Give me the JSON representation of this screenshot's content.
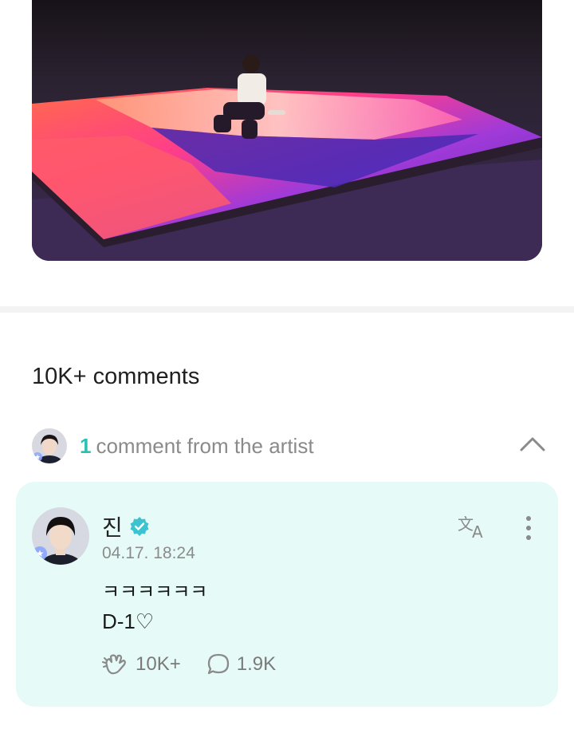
{
  "post": {
    "photo_alt": "artist photo"
  },
  "comments_section": {
    "count_label": "10K+ comments"
  },
  "artist_comments": {
    "count": "1",
    "label": "comment from the artist"
  },
  "comment": {
    "author": "진",
    "timestamp": "04.17. 18:24",
    "line1": "ㅋㅋㅋㅋㅋㅋ",
    "line2": "D-1♡",
    "likes": "10K+",
    "replies": "1.9K"
  },
  "icons": {
    "verified": "verified-badge-icon",
    "translate": "translate-icon",
    "more": "more-vertical-icon",
    "like": "cheer-hand-icon",
    "reply": "speech-bubble-icon",
    "collapse": "chevron-up-icon"
  },
  "colors": {
    "accent": "#2bc0b4",
    "card_bg": "#e6fbf7",
    "verified": "#3dc2cf"
  }
}
